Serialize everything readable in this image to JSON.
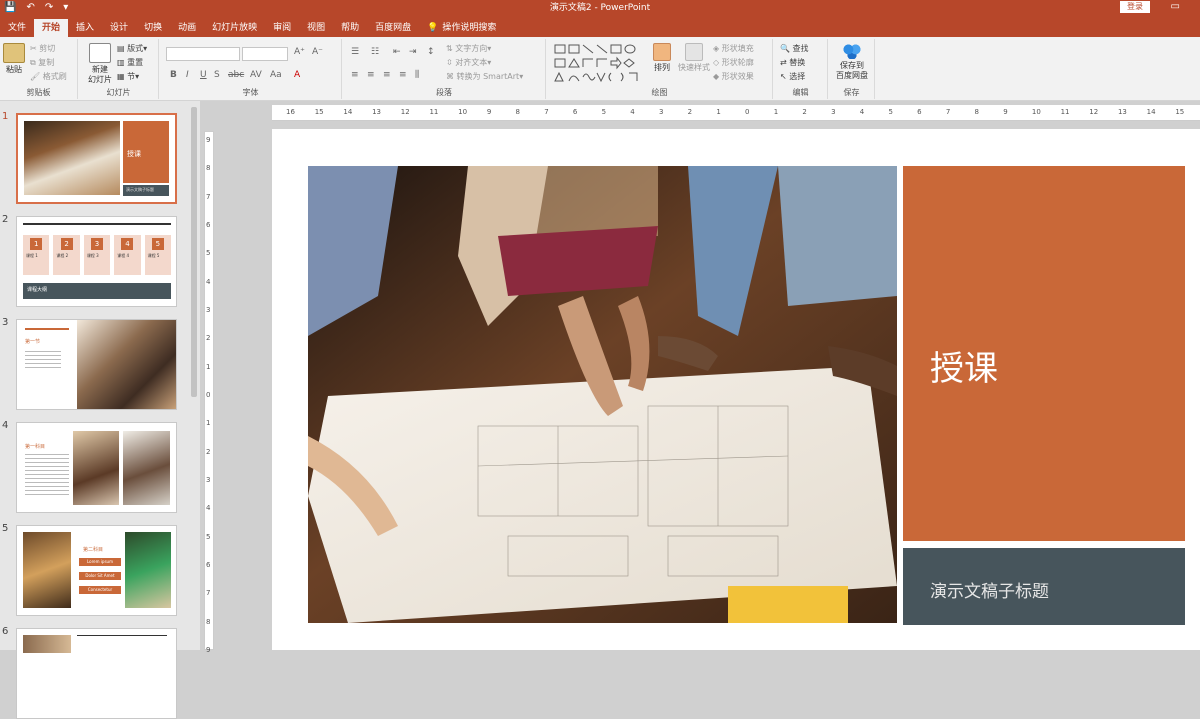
{
  "window": {
    "title": "演示文稿2 - PowerPoint",
    "login": "登录"
  },
  "tabs": [
    {
      "label": "文件"
    },
    {
      "label": "开始",
      "active": true
    },
    {
      "label": "插入"
    },
    {
      "label": "设计"
    },
    {
      "label": "切换"
    },
    {
      "label": "动画"
    },
    {
      "label": "幻灯片放映"
    },
    {
      "label": "审阅"
    },
    {
      "label": "视图"
    },
    {
      "label": "帮助"
    },
    {
      "label": "百度网盘"
    }
  ],
  "tell_me": "操作说明搜索",
  "ribbon": {
    "clipboard": {
      "label": "剪贴板",
      "paste": "粘贴",
      "cut": "剪切",
      "copy": "复制",
      "format_painter": "格式刷"
    },
    "slides": {
      "label": "幻灯片",
      "new_slide": "新建",
      "new_slide2": "幻灯片",
      "layout": "版式",
      "reset": "重置",
      "section": "节"
    },
    "font": {
      "label": "字体"
    },
    "paragraph": {
      "label": "段落",
      "text_direction": "文字方向",
      "align_text": "对齐文本",
      "smartart": "转换为 SmartArt"
    },
    "drawing": {
      "label": "绘图",
      "arrange": "排列",
      "quick_styles": "快速样式",
      "shape_fill": "形状填充",
      "shape_outline": "形状轮廓",
      "shape_effects": "形状效果"
    },
    "editing": {
      "label": "编辑",
      "find": "查找",
      "replace": "替换",
      "select": "选择"
    },
    "save": {
      "label": "保存",
      "save_to": "保存到",
      "baidu": "百度网盘"
    }
  },
  "thumbnails": [
    {
      "num": "1",
      "title": "授课",
      "subtitle": "演示文稿子标题"
    },
    {
      "num": "2",
      "title": "课程大纲",
      "steps": [
        "1",
        "2",
        "3",
        "4",
        "5"
      ],
      "step_label": "课程 1",
      "step_labels": [
        "课程 1",
        "课程 2",
        "课程 3",
        "课程 4",
        "课程 5"
      ]
    },
    {
      "num": "3",
      "title": "第一节"
    },
    {
      "num": "4",
      "title": "第一科目"
    },
    {
      "num": "5",
      "title": "第二科目",
      "buttons": [
        "Lorem ipsum",
        "Dolor Sit Amet",
        "Consectetur"
      ]
    },
    {
      "num": "6"
    }
  ],
  "ruler": [
    "16",
    "15",
    "14",
    "13",
    "12",
    "11",
    "10",
    "9",
    "8",
    "7",
    "6",
    "5",
    "4",
    "3",
    "2",
    "1",
    "0",
    "1",
    "2",
    "3",
    "4",
    "5",
    "6",
    "7",
    "8",
    "9",
    "10",
    "11",
    "12",
    "13",
    "14",
    "15",
    "16"
  ],
  "vruler": [
    "9",
    "8",
    "7",
    "6",
    "5",
    "4",
    "3",
    "2",
    "1",
    "0",
    "1",
    "2",
    "3",
    "4",
    "5",
    "6",
    "7",
    "8",
    "9"
  ],
  "slide": {
    "title": "授课",
    "subtitle": "演示文稿子标题"
  },
  "colors": {
    "accent": "#b7472a",
    "title_box": "#c96838",
    "subtitle_box": "#47555c"
  }
}
